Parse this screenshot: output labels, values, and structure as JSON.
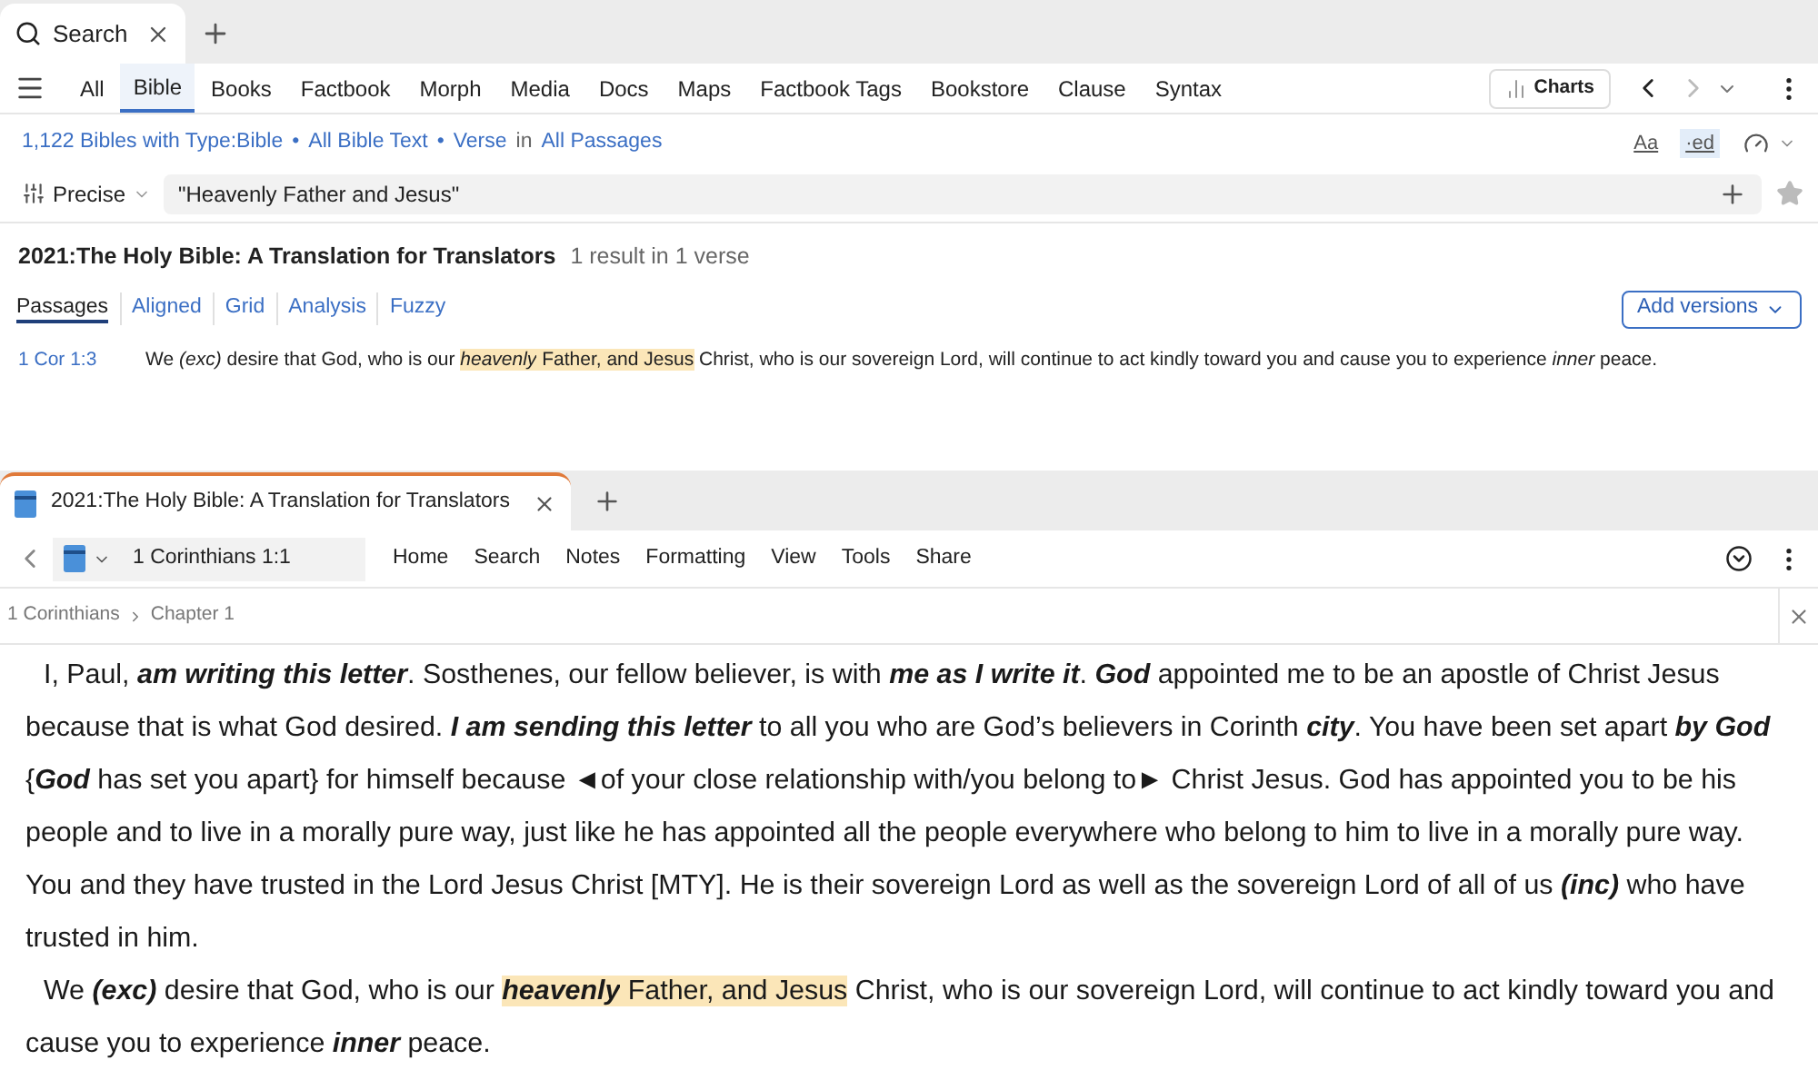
{
  "top_tabs": [
    {
      "label": "Search",
      "selected": true
    }
  ],
  "nav_tabs": [
    {
      "label": "All",
      "selected": false
    },
    {
      "label": "Bible",
      "selected": true
    },
    {
      "label": "Books",
      "selected": false
    },
    {
      "label": "Factbook",
      "selected": false
    },
    {
      "label": "Morph",
      "selected": false
    },
    {
      "label": "Media",
      "selected": false
    },
    {
      "label": "Docs",
      "selected": false
    },
    {
      "label": "Maps",
      "selected": false
    },
    {
      "label": "Factbook Tags",
      "selected": false
    },
    {
      "label": "Bookstore",
      "selected": false
    },
    {
      "label": "Clause",
      "selected": false
    },
    {
      "label": "Syntax",
      "selected": false
    }
  ],
  "charts_button": "Charts",
  "scope": [
    {
      "kind": "link",
      "text": "1,122 Bibles with Type:Bible"
    },
    {
      "kind": "dot",
      "text": "•"
    },
    {
      "kind": "link",
      "text": "All Bible Text"
    },
    {
      "kind": "dot",
      "text": "•"
    },
    {
      "kind": "link",
      "text": "Verse"
    },
    {
      "kind": "plain",
      "text": "in"
    },
    {
      "kind": "link",
      "text": "All Passages"
    }
  ],
  "format_toggles": [
    {
      "label": "Aa",
      "selected": false
    },
    {
      "label": "·ed",
      "selected": true
    }
  ],
  "search": {
    "mode": "Precise",
    "value": "\"Heavenly Father and Jesus\""
  },
  "result": {
    "title": "2021:The Holy Bible: A Translation for Translators",
    "count": "1 result in 1 verse"
  },
  "result_tabs": [
    {
      "label": "Passages",
      "selected": true
    },
    {
      "label": "Aligned",
      "selected": false
    },
    {
      "label": "Grid",
      "selected": false
    },
    {
      "label": "Analysis",
      "selected": false
    },
    {
      "label": "Fuzzy",
      "selected": false
    }
  ],
  "add_versions": "Add versions",
  "hits": [
    {
      "ref": "1 Cor 1:3",
      "segments": [
        {
          "text": "We ",
          "kind": "normal",
          "highlight": false
        },
        {
          "text": "(exc)",
          "kind": "italic",
          "highlight": false
        },
        {
          "text": " desire that God, who is our ",
          "kind": "normal",
          "highlight": false
        },
        {
          "text": "heavenly",
          "kind": "italic",
          "highlight": true
        },
        {
          "text": " Father, and Jesus",
          "kind": "normal",
          "highlight": true
        },
        {
          "text": " Christ, who is our sovereign Lord, will continue to act kindly toward you and cause you to experience ",
          "kind": "normal",
          "highlight": false
        },
        {
          "text": "inner",
          "kind": "italic",
          "highlight": false
        },
        {
          "text": " peace.",
          "kind": "normal",
          "highlight": false
        }
      ]
    }
  ],
  "doc_tabs": [
    {
      "label": "2021:The Holy Bible: A Translation for Translators",
      "selected": true
    }
  ],
  "reference": "1 Corinthians 1:1",
  "menu": [
    "Home",
    "Search",
    "Notes",
    "Formatting",
    "View",
    "Tools",
    "Share"
  ],
  "breadcrumb": [
    "1 Corinthians",
    "Chapter 1"
  ],
  "paragraphs": [
    {
      "segments": [
        {
          "text": "I, Paul, ",
          "kind": "normal",
          "highlight": false
        },
        {
          "text": "am writing this letter",
          "kind": "bold_italic",
          "highlight": false
        },
        {
          "text": ". Sosthenes, our fellow believer, is with ",
          "kind": "normal",
          "highlight": false
        },
        {
          "text": "me as I write it",
          "kind": "bold_italic",
          "highlight": false
        },
        {
          "text": ". ",
          "kind": "normal",
          "highlight": false
        },
        {
          "text": "God",
          "kind": "bold_italic",
          "highlight": false
        },
        {
          "text": " appointed me to be an apostle of Christ Jesus because that is what God desired.  ",
          "kind": "normal",
          "highlight": false
        },
        {
          "text": "I am sending this letter",
          "kind": "bold_italic",
          "highlight": false
        },
        {
          "text": " to all you who are God’s believers in Corinth ",
          "kind": "normal",
          "highlight": false
        },
        {
          "text": "city",
          "kind": "bold_italic",
          "highlight": false
        },
        {
          "text": ". You have been set apart ",
          "kind": "normal",
          "highlight": false
        },
        {
          "text": "by God",
          "kind": "bold_italic",
          "highlight": false
        },
        {
          "text": " {",
          "kind": "normal",
          "highlight": false
        },
        {
          "text": "God",
          "kind": "bold_italic",
          "highlight": false
        },
        {
          "text": " has set you apart} for himself because ◄of your close relationship with/you belong to► Christ Jesus. God has appointed you to be his people and to live in a morally pure way, just like he has appointed all the people everywhere who belong to him to live in a morally pure way. You and they have trusted in the Lord Jesus Christ [MTY]. He is their sovereign Lord as well as the sovereign Lord of all of us ",
          "kind": "normal",
          "highlight": false
        },
        {
          "text": "(inc)",
          "kind": "bold_italic",
          "highlight": false
        },
        {
          "text": " who have trusted in him.",
          "kind": "normal",
          "highlight": false
        }
      ]
    },
    {
      "segments": [
        {
          "text": "We ",
          "kind": "normal",
          "highlight": false
        },
        {
          "text": "(exc)",
          "kind": "bold_italic",
          "highlight": false
        },
        {
          "text": " desire that God, who is our ",
          "kind": "normal",
          "highlight": false
        },
        {
          "text": "heavenly",
          "kind": "bold_italic",
          "highlight": true
        },
        {
          "text": " Father, and Jesus",
          "kind": "normal",
          "highlight": true
        },
        {
          "text": " Christ, who is our sovereign Lord, will continue to act kindly toward you and cause you to experience ",
          "kind": "normal",
          "highlight": false
        },
        {
          "text": "inner",
          "kind": "bold_italic",
          "highlight": false
        },
        {
          "text": " peace.",
          "kind": "normal",
          "highlight": false
        }
      ]
    }
  ]
}
